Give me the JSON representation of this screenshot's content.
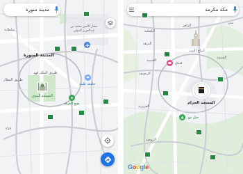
{
  "left_panel": {
    "search": {
      "query": "مدينة منورة"
    },
    "labels": {
      "airport": "مطار الأمير محمد بن عبدالعزيز الدولي",
      "city": "المدينة المنورة",
      "university": "جامعة طيبة",
      "mosque": "المسجد النبوي",
      "baqi": "بقيع الغرقد",
      "road_east": "طريق الملك فهد",
      "area_west": "طريق المطار",
      "area_north": "سلطانة",
      "area_south": "قباء"
    },
    "icons": [
      "mic-icon",
      "layers-icon",
      "airport-icon",
      "location-icon",
      "directions-icon"
    ]
  },
  "right_panel": {
    "search": {
      "query": "مكة مكرمة"
    },
    "labels": {
      "district_1": "الكعكية",
      "district_2": "الزاهر",
      "district_3": "النزهة",
      "district_4": "العتيبية",
      "clock": "أبراج البيت",
      "haram": "المسجد الحرام",
      "nur": "جبل نور",
      "rusaifa": "الرصيفة",
      "shisha": "الششة",
      "aziziyah": "العزيزية",
      "mina": "منى",
      "hotel": "فندق",
      "rawdah": "الروضة"
    },
    "icons": [
      "menu-icon",
      "mic-icon",
      "kaaba-icon",
      "clock-tower-icon"
    ]
  },
  "footer": {
    "logo": "Google"
  }
}
